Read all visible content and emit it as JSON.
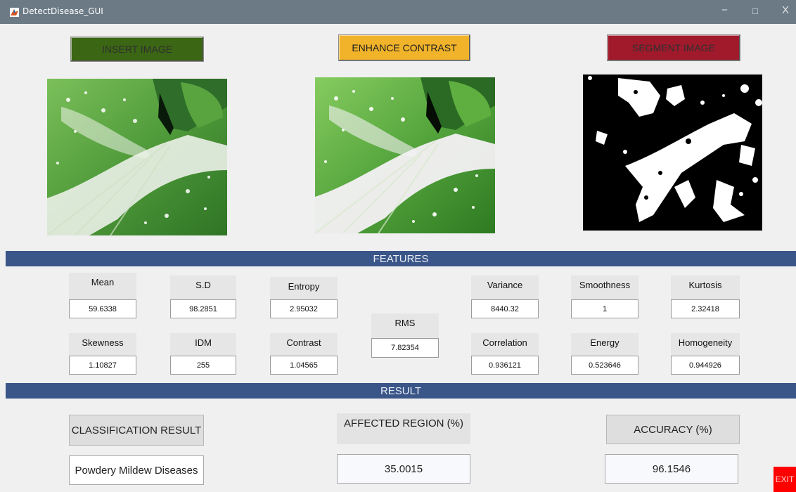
{
  "window": {
    "title": "DetectDisease_GUI",
    "controls": {
      "minimize": "−",
      "maximize": "□",
      "close": "X"
    }
  },
  "buttons": {
    "insert_image": {
      "label": "INSERT IMAGE",
      "color": "#3b6614",
      "text_color": "#2f2f2f"
    },
    "enhance_contrast": {
      "label": "ENHANCE CONTRAST",
      "color": "#f0b32a",
      "text_color": "#1e1e1e"
    },
    "segment_image": {
      "label": "SEGMENT IMAGE",
      "color": "#a01a2c",
      "text_color": "#2f2f2f"
    }
  },
  "sections": {
    "features": "FEATURES",
    "result": "RESULT"
  },
  "features": {
    "mean": {
      "label": "Mean",
      "value": "59.6338"
    },
    "sd": {
      "label": "S.D",
      "value": "98.2851"
    },
    "entropy": {
      "label": "Entropy",
      "value": "2.95032"
    },
    "rms": {
      "label": "RMS",
      "value": "7.82354"
    },
    "variance": {
      "label": "Variance",
      "value": "8440.32"
    },
    "smoothness": {
      "label": "Smoothness",
      "value": "1"
    },
    "kurtosis": {
      "label": "Kurtosis",
      "value": "2.32418"
    },
    "skewness": {
      "label": "Skewness",
      "value": "1.10827"
    },
    "idm": {
      "label": "IDM",
      "value": "255"
    },
    "contrast": {
      "label": "Contrast",
      "value": "1.04565"
    },
    "correlation": {
      "label": "Correlation",
      "value": "0.936121"
    },
    "energy": {
      "label": "Energy",
      "value": "0.523646"
    },
    "homogeneity": {
      "label": "Homogeneity",
      "value": "0.944926"
    }
  },
  "results": {
    "classification": {
      "label": "CLASSIFICATION RESULT",
      "value": "Powdery  Mildew Diseases"
    },
    "affected_region": {
      "label": "AFFECTED REGION (%)",
      "value": "35.0015"
    },
    "accuracy": {
      "label": "ACCURACY (%)",
      "value": "96.1546"
    }
  },
  "exit": {
    "label": "EXIT",
    "color": "#ff0000"
  },
  "images": {
    "original": "leaf-photo",
    "enhanced": "leaf-photo-enhanced",
    "segmented": "segmentation-mask"
  }
}
